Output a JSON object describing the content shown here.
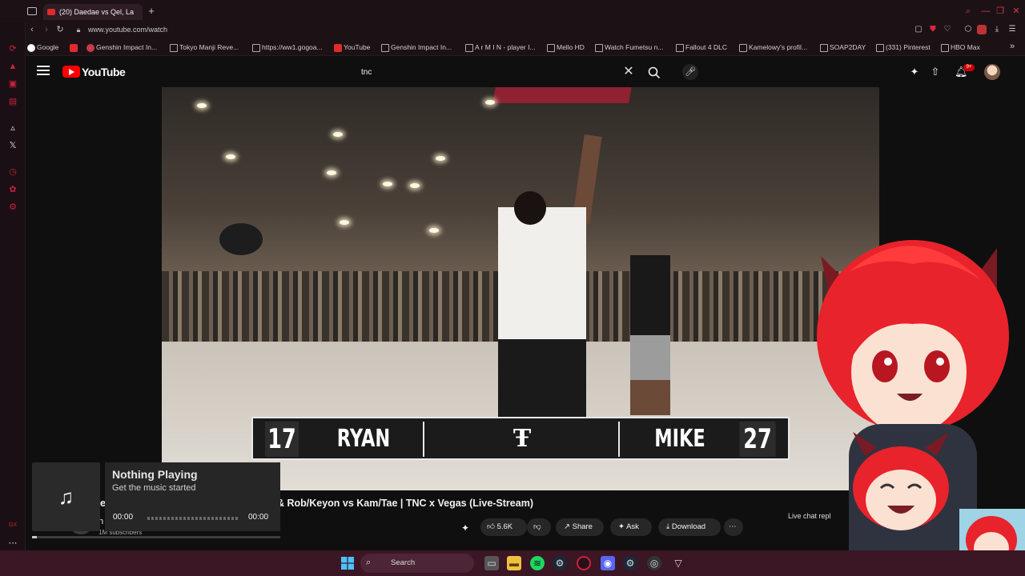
{
  "browser": {
    "tab_title": "(20) Daedae vs Qel, La",
    "url": "www.youtube.com/watch",
    "bookmarks": [
      {
        "label": "Google",
        "kind": "g"
      },
      {
        "label": "",
        "kind": "y"
      },
      {
        "label": "Genshin Impact In...",
        "kind": "p"
      },
      {
        "label": "Tokyo Manji Reve...",
        "kind": "d"
      },
      {
        "label": "https://ww1.gogoa...",
        "kind": "d"
      },
      {
        "label": "YouTube",
        "kind": "y"
      },
      {
        "label": "Genshin Impact In...",
        "kind": "d"
      },
      {
        "label": "A r M I N - player I...",
        "kind": "d"
      },
      {
        "label": "Mello HD",
        "kind": "d"
      },
      {
        "label": "Watch Fumetsu n...",
        "kind": "d"
      },
      {
        "label": "Fallout 4 DLC",
        "kind": "d"
      },
      {
        "label": "Kamelowy's profil...",
        "kind": "d"
      },
      {
        "label": "SOAP2DAY",
        "kind": "d"
      },
      {
        "label": "(331) Pinterest",
        "kind": "d"
      },
      {
        "label": "HBO Max",
        "kind": "d"
      }
    ]
  },
  "youtube": {
    "logo_text": "YouTube",
    "search_value": "tnc",
    "notification_count": "9+"
  },
  "scoreboard": {
    "left_score": "17",
    "left_name": "RYAN",
    "right_name": "MIKE",
    "right_score": "27"
  },
  "music_overlay": {
    "title": "Nothing Playing",
    "subtitle": "Get the music started",
    "time_elapsed": "00:00",
    "time_total": "00:00"
  },
  "video_info": {
    "title": "e vs Qel, Lat vs Reese, Ryan vs Mike & Rob/Keyon vs Kam/Tae | TNC x Vegas (Live-Stream)",
    "channel_initial": "n",
    "subscribers": "1M subscribers",
    "likes": "5.6K",
    "share_label": "Share",
    "ask_label": "Ask",
    "download_label": "Download",
    "live_chat_label": "Live chat repl"
  },
  "taskbar": {
    "search_label": "Search"
  }
}
